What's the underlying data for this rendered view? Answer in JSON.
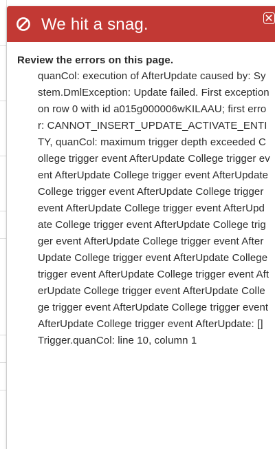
{
  "dialog": {
    "title": "We hit a snag.",
    "heading": "Review the errors on this page.",
    "errors": [
      "quanCol: execution of AfterUpdate caused by: System.DmlException: Update failed. First exception on row 0 with id a015g000006wKILAAU; first error: CANNOT_INSERT_UPDATE_ACTIVATE_ENTITY, quanCol: maximum trigger depth exceeded College trigger event AfterUpdate College trigger event AfterUpdate College trigger event AfterUpdate College trigger event AfterUpdate College trigger event AfterUpdate College trigger event AfterUpdate College trigger event AfterUpdate College trigger event AfterUpdate College trigger event AfterUpdate College trigger event AfterUpdate College trigger event AfterUpdate College trigger event AfterUpdate College trigger event AfterUpdate College trigger event AfterUpdate College trigger event AfterUpdate College trigger event AfterUpdate: [] Trigger.quanCol: line 10, column 1"
    ],
    "icons": {
      "header": "ban-icon",
      "close": "close-icon"
    },
    "colors": {
      "header_bg": "#c23934",
      "header_text": "#ffffff",
      "body_text": "#2a2a2a"
    }
  }
}
